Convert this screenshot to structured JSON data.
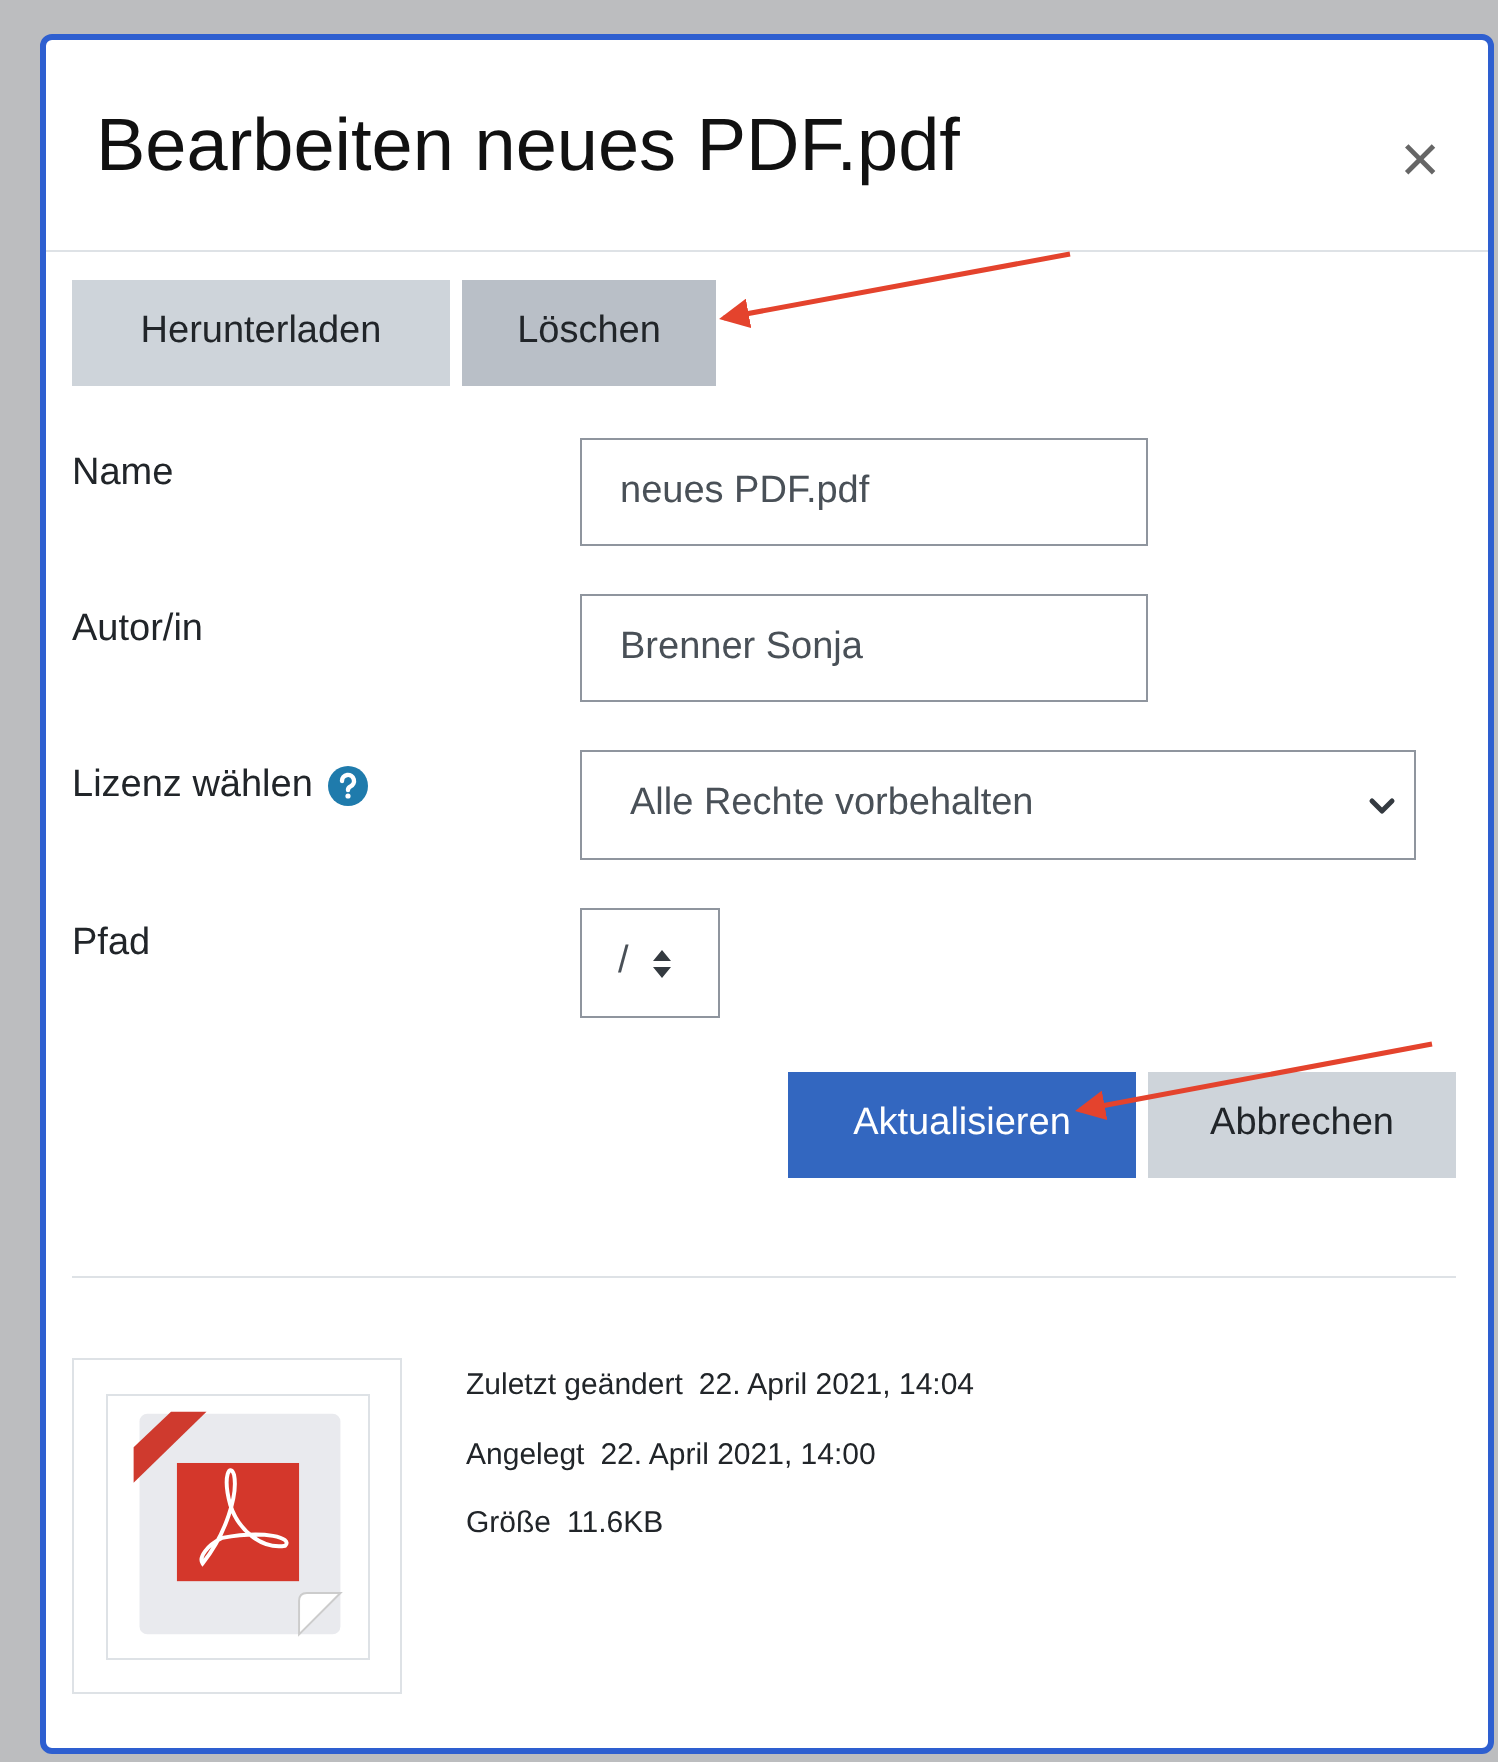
{
  "dialog": {
    "title": "Bearbeiten neues PDF.pdf",
    "close": "×"
  },
  "file_actions": [
    {
      "label": "Herunterladen",
      "highlighted": false
    },
    {
      "label": "Löschen",
      "highlighted": true
    }
  ],
  "fields": [
    {
      "kind": "text",
      "label": "Name",
      "value": "neues PDF.pdf"
    },
    {
      "kind": "text",
      "label": "Autor/in",
      "value": "Brenner Sonja"
    },
    {
      "kind": "select",
      "label": "Lizenz wählen",
      "help": true,
      "value": "Alle Rechte vorbehalten"
    },
    {
      "kind": "spinner",
      "label": "Pfad",
      "value": "/"
    }
  ],
  "buttons": [
    {
      "kind": "primary",
      "label": "Aktualisieren"
    },
    {
      "kind": "secondary",
      "label": "Abbrechen"
    }
  ],
  "file_info": [
    {
      "label": "Zuletzt geändert",
      "value": "22. April 2021, 14:04"
    },
    {
      "label": "Angelegt",
      "value": "22. April 2021, 14:00"
    },
    {
      "label": "Größe",
      "value": "11.6KB"
    }
  ]
}
